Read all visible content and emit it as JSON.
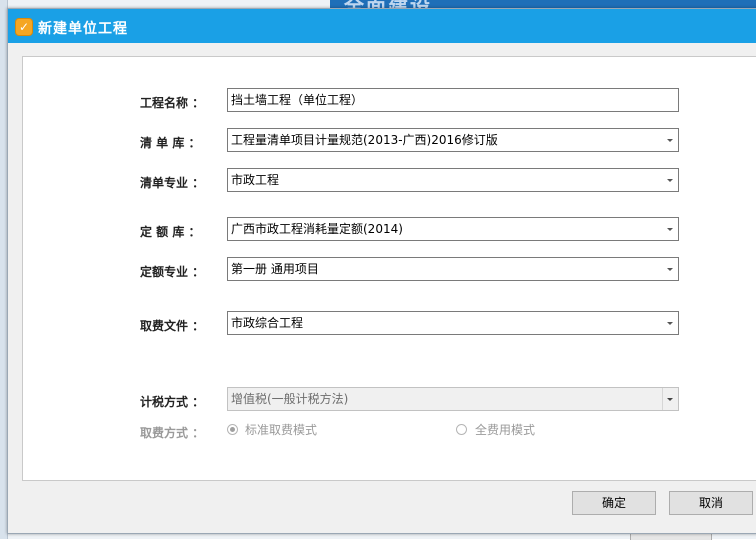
{
  "background": {
    "title_fragment": "全面建设"
  },
  "dialog": {
    "title": "新建单位工程",
    "icon": "app-logo-icon"
  },
  "form": {
    "project_name": {
      "label": "工程名称 ：",
      "value": "挡土墙工程（单位工程）"
    },
    "bill_library": {
      "label": "清 单 库 ：",
      "value": "工程量清单项目计量规范(2013-广西)2016修订版"
    },
    "bill_specialty": {
      "label": "清单专业 ：",
      "value": "市政工程"
    },
    "quota_library": {
      "label": "定 额 库 ：",
      "value": "广西市政工程消耗量定额(2014)"
    },
    "quota_specialty": {
      "label": "定额专业 ：",
      "value": "第一册 通用项目"
    },
    "fee_file": {
      "label": "取费文件 ：",
      "value": "市政综合工程"
    },
    "tax_method": {
      "label": "计税方式 ：",
      "value": "增值税(一般计税方法)"
    },
    "fee_mode": {
      "label": "取费方式 ：",
      "options": [
        "标准取费模式",
        "全费用模式"
      ],
      "selected": "标准取费模式"
    }
  },
  "buttons": {
    "ok": "确定",
    "cancel": "取消"
  },
  "colors": {
    "titlebar": "#1aa0e6",
    "panel": "#ffffff",
    "dialog_bg": "#f0f0f0"
  }
}
